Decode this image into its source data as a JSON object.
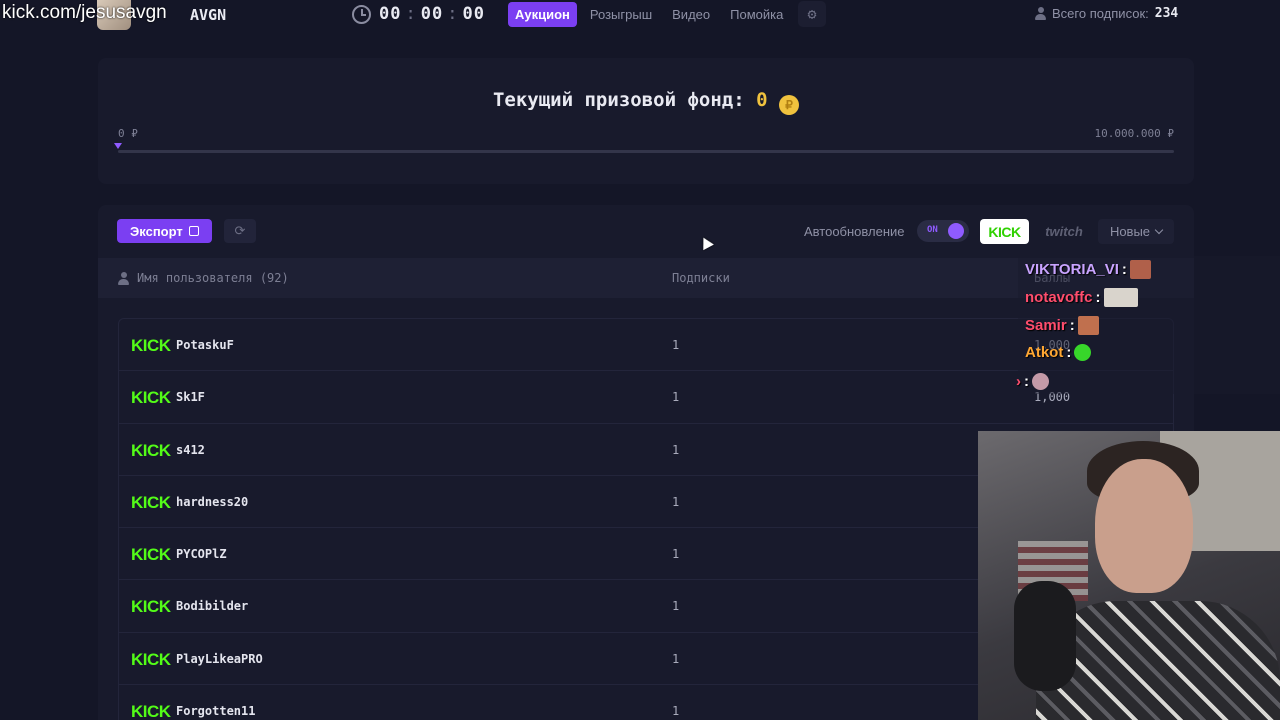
{
  "overlay_url": "kick.com/jesusavgn",
  "brand": {
    "name": "AVGN"
  },
  "timer": {
    "hours": "00",
    "minutes": "00",
    "seconds": "00"
  },
  "nav": {
    "tabs": [
      {
        "label": "Аукцион",
        "active": true
      },
      {
        "label": "Розыгрыш",
        "active": false
      },
      {
        "label": "Видео",
        "active": false
      },
      {
        "label": "Помойка",
        "active": false
      }
    ],
    "settings_icon": "gear-icon"
  },
  "subs_total": {
    "label": "Всего подписок:",
    "value": "234"
  },
  "prize": {
    "title": "Текущий призовой фонд:",
    "amount": "0",
    "coin_symbol": "₽",
    "min_label": "0 ₽",
    "max_label": "10.000.000 ₽",
    "progress_fraction": 0
  },
  "toolbar": {
    "export_label": "Экспорт",
    "auto_update_label": "Автообновление",
    "toggle_state": "ON",
    "kick_filter": "KICK",
    "twitch_filter": "twitch",
    "sort_label": "Новые"
  },
  "table": {
    "headers": {
      "user": "Имя пользователя (92)",
      "subs": "Подписки",
      "points": "Баллы"
    },
    "rows": [
      {
        "platform": "KICK",
        "username": "PotaskuF",
        "subs": "1",
        "points": "1,000"
      },
      {
        "platform": "KICK",
        "username": "Sk1F",
        "subs": "1",
        "points": "1,000"
      },
      {
        "platform": "KICK",
        "username": "s412",
        "subs": "1",
        "points": ""
      },
      {
        "platform": "KICK",
        "username": "hardness20",
        "subs": "1",
        "points": ""
      },
      {
        "platform": "KICK",
        "username": "PYCOPlZ",
        "subs": "1",
        "points": ""
      },
      {
        "platform": "KICK",
        "username": "Bodibilder",
        "subs": "1",
        "points": ""
      },
      {
        "platform": "KICK",
        "username": "PlayLikeaPRO",
        "subs": "1",
        "points": ""
      },
      {
        "platform": "KICK",
        "username": "Forgotten11",
        "subs": "1",
        "points": ""
      }
    ]
  },
  "chat": {
    "messages": [
      {
        "user": "VIKTORIA_VI",
        "color": "#c9a4ff",
        "emote_color": "#b0604a"
      },
      {
        "user": "notavoffc",
        "color": "#ff4d6d",
        "emote_color": "#d9d4cc"
      },
      {
        "user": "Samir",
        "color": "#ff4d6d",
        "emote_color": "#c0704e"
      },
      {
        "user": "Atkot",
        "color": "#ffa733",
        "emote_color": "#37d62a"
      },
      {
        "user": "",
        "color": "#ff4d6d",
        "emote_color": "#c49aa8"
      }
    ]
  },
  "colors": {
    "accent": "#7b3ff2",
    "kick_green": "#53fc18",
    "gold": "#f0c23e",
    "background": "#141627"
  }
}
